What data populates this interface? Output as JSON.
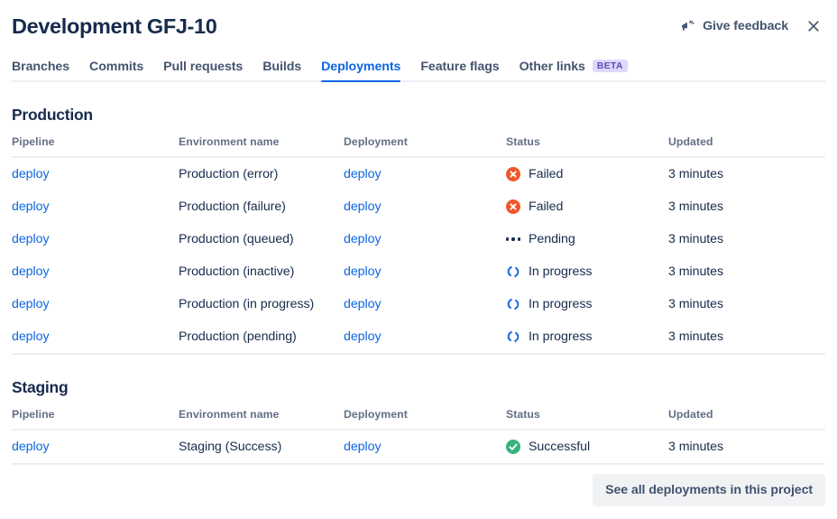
{
  "header": {
    "title": "Development GFJ-10",
    "feedback_label": "Give feedback",
    "feedback_icon": "megaphone-icon",
    "close_icon": "close-icon"
  },
  "tabs": [
    {
      "label": "Branches",
      "active": false
    },
    {
      "label": "Commits",
      "active": false
    },
    {
      "label": "Pull requests",
      "active": false
    },
    {
      "label": "Builds",
      "active": false
    },
    {
      "label": "Deployments",
      "active": true
    },
    {
      "label": "Feature flags",
      "active": false
    },
    {
      "label": "Other links",
      "active": false,
      "badge": "BETA"
    }
  ],
  "columns": [
    "Pipeline",
    "Environment name",
    "Deployment",
    "Status",
    "Updated"
  ],
  "sections": [
    {
      "title": "Production",
      "rows": [
        {
          "pipeline": "deploy",
          "environment": "Production (error)",
          "deployment": "deploy",
          "status": "Failed",
          "status_icon": "failed-icon",
          "updated": "3 minutes"
        },
        {
          "pipeline": "deploy",
          "environment": "Production (failure)",
          "deployment": "deploy",
          "status": "Failed",
          "status_icon": "failed-icon",
          "updated": "3 minutes"
        },
        {
          "pipeline": "deploy",
          "environment": "Production (queued)",
          "deployment": "deploy",
          "status": "Pending",
          "status_icon": "pending-icon",
          "updated": "3 minutes"
        },
        {
          "pipeline": "deploy",
          "environment": "Production (inactive)",
          "deployment": "deploy",
          "status": "In progress",
          "status_icon": "in-progress-icon",
          "updated": "3 minutes"
        },
        {
          "pipeline": "deploy",
          "environment": "Production (in progress)",
          "deployment": "deploy",
          "status": "In progress",
          "status_icon": "in-progress-icon",
          "updated": "3 minutes"
        },
        {
          "pipeline": "deploy",
          "environment": "Production (pending)",
          "deployment": "deploy",
          "status": "In progress",
          "status_icon": "in-progress-icon",
          "updated": "3 minutes"
        }
      ]
    },
    {
      "title": "Staging",
      "rows": [
        {
          "pipeline": "deploy",
          "environment": "Staging (Success)",
          "deployment": "deploy",
          "status": "Successful",
          "status_icon": "successful-icon",
          "updated": "3 minutes"
        }
      ]
    }
  ],
  "footer": {
    "see_all_label": "See all deployments in this project"
  },
  "colors": {
    "link": "#0c66e4",
    "active_tab": "#0c66e4",
    "text": "#172b4d",
    "muted": "#626f86",
    "failed": "#f1562b",
    "success": "#36b37e",
    "in_progress": "#0c66e4",
    "pending": "#172b4d",
    "beta_bg": "#dfd8fd",
    "beta_text": "#5e4db2",
    "button_bg": "#f1f2f4",
    "border": "#eceef1"
  }
}
